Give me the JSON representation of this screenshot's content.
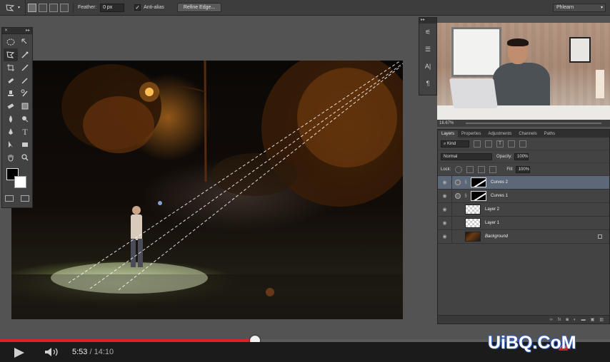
{
  "options_bar": {
    "feather_label": "Feather:",
    "feather_value": "0 px",
    "antialias_label": "Anti-alias",
    "antialias_checked": "✓",
    "refine_edge_label": "Refine Edge...",
    "workspace_label": "Phlearn",
    "workspace_chevron": "▾"
  },
  "side_panel": {
    "collapse_glyph": "▸▸",
    "items": [
      "⚟",
      "☰",
      "A|",
      "¶"
    ]
  },
  "webcam": {
    "zoom": "16.67%"
  },
  "layers_panel": {
    "tabs": [
      "Layers",
      "Properties",
      "Adjustments",
      "Channels",
      "Paths"
    ],
    "filter_kind": "Kind",
    "blend_mode": "Normal",
    "opacity_label": "Opacity:",
    "opacity_value": "100%",
    "lock_label": "Lock:",
    "fill_label": "Fill:",
    "fill_value": "100%",
    "layers": [
      {
        "name": "Curves 2"
      },
      {
        "name": "Curves 1"
      },
      {
        "name": "Layer 2"
      },
      {
        "name": "Layer 1"
      },
      {
        "name": "Background"
      }
    ]
  },
  "player": {
    "current_time": "5:53",
    "separator": " / ",
    "total_time": "14:10",
    "progress_fraction": 0.418,
    "hd_badge": "HD"
  },
  "watermark": "UiBQ.CoM",
  "colors": {
    "progress_played": "#e02020",
    "selected_layer": "#5c6878",
    "foreground_swatch": "#000000",
    "background_swatch": "#ffffff"
  },
  "icons": [
    "lasso-polygon-icon",
    "move-icon",
    "crop-icon",
    "brush-icon",
    "eye-icon",
    "lock-icon",
    "play-icon",
    "volume-icon"
  ]
}
